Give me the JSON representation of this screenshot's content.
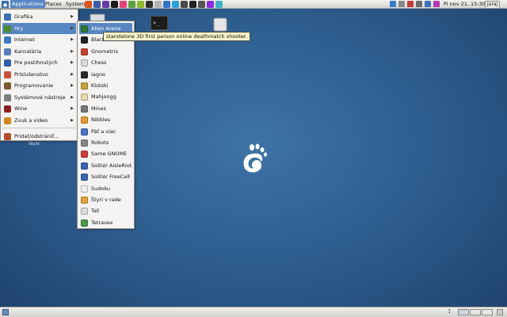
{
  "top_panel": {
    "menus": [
      "Applications",
      "Places",
      "System"
    ],
    "clock": "Pi nov 21, 15:30",
    "user": "juraj"
  },
  "desktop": {
    "hidden_label": "WaW"
  },
  "apps_menu": {
    "items": [
      {
        "label": "Grafika",
        "icon": "graphics-icon",
        "color": "#3a6fb0",
        "submenu": true
      },
      {
        "label": "Hry",
        "icon": "games-icon",
        "color": "#4f8a2f",
        "submenu": true,
        "active": true
      },
      {
        "label": "Internet",
        "icon": "internet-icon",
        "color": "#3c78c8",
        "submenu": true
      },
      {
        "label": "Kancelária",
        "icon": "office-icon",
        "color": "#5a7fb8",
        "submenu": true
      },
      {
        "label": "Pre postihnutých",
        "icon": "accessibility-icon",
        "color": "#2f5fa6",
        "submenu": true
      },
      {
        "label": "Príslušenstvo",
        "icon": "accessories-icon",
        "color": "#c6533b",
        "submenu": true
      },
      {
        "label": "Programovanie",
        "icon": "programming-icon",
        "color": "#7b5a2e",
        "submenu": true
      },
      {
        "label": "Systémové nástroje",
        "icon": "system-tools-icon",
        "color": "#7d7d7d",
        "submenu": true
      },
      {
        "label": "Wine",
        "icon": "wine-icon",
        "color": "#8a1f1f",
        "submenu": true
      },
      {
        "label": "Zvuk a video",
        "icon": "sound-video-icon",
        "color": "#d08a1a",
        "submenu": true
      },
      {
        "label": "Pridať/odstrániť...",
        "icon": "add-remove-icon",
        "color": "#b54a2a",
        "submenu": false
      }
    ]
  },
  "games_menu": {
    "items": [
      {
        "label": "Alien Arena",
        "icon": "alien-arena-icon",
        "color": "#2f7a2f"
      },
      {
        "label": "Black",
        "icon": "blackjack-icon",
        "color": "#222222"
      },
      {
        "label": "Gnometris",
        "icon": "gnometris-icon",
        "color": "#c4442c"
      },
      {
        "label": "Chess",
        "icon": "chess-icon",
        "color": "#d9d9d9"
      },
      {
        "label": "Iagno",
        "icon": "iagno-icon",
        "color": "#2a2a2a"
      },
      {
        "label": "Klotski",
        "icon": "klotski-icon",
        "color": "#c9a23c"
      },
      {
        "label": "Mahjongg",
        "icon": "mahjongg-icon",
        "color": "#e8d7b0"
      },
      {
        "label": "Mines",
        "icon": "mines-icon",
        "color": "#777777"
      },
      {
        "label": "Nibbles",
        "icon": "nibbles-icon",
        "color": "#e39a2a"
      },
      {
        "label": "Päť a viac",
        "icon": "five-or-more-icon",
        "color": "#4a74c4"
      },
      {
        "label": "Robots",
        "icon": "robots-icon",
        "color": "#888888"
      },
      {
        "label": "Same GNOME",
        "icon": "same-gnome-icon",
        "color": "#cf3a3a"
      },
      {
        "label": "Solitér AisleRiot",
        "icon": "aisleriot-icon",
        "color": "#3a64b0"
      },
      {
        "label": "Solitér FreeCell",
        "icon": "freecell-icon",
        "color": "#3a64b0"
      },
      {
        "label": "Sudoku",
        "icon": "sudoku-icon",
        "color": "#f0f0f0"
      },
      {
        "label": "Štyri v rade",
        "icon": "four-in-a-row-icon",
        "color": "#e2a43a"
      },
      {
        "label": "Tali",
        "icon": "tali-icon",
        "color": "#dddddd"
      },
      {
        "label": "Tetravex",
        "icon": "tetravex-icon",
        "color": "#4a9a4a"
      }
    ]
  },
  "tooltip": "standalone 3D first person online deathmatch shooter."
}
